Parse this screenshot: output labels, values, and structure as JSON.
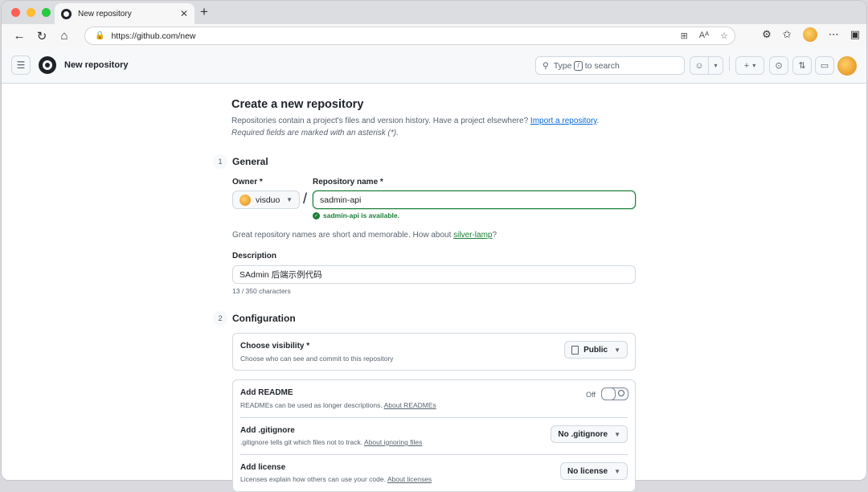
{
  "browser": {
    "tab_title": "New repository",
    "url": "https://github.com/new"
  },
  "header": {
    "context_title": "New repository",
    "search_prefix": "Type",
    "search_key": "/",
    "search_suffix": "to search"
  },
  "page": {
    "title": "Create a new repository",
    "intro": "Repositories contain a project's files and version history. Have a project elsewhere?",
    "import_link": "Import a repository",
    "intro_end": ".",
    "required_note": "Required fields are marked with an asterisk (*)."
  },
  "general": {
    "step": "1",
    "title": "General",
    "owner_label": "Owner *",
    "owner_value": "visduo",
    "slash": "/",
    "repo_label": "Repository name *",
    "repo_value": "sadmin-api",
    "available_msg": "sadmin-api is available.",
    "suggest_text": "Great repository names are short and memorable. How about",
    "suggest_link": "silver-lamp",
    "suggest_end": "?",
    "description_label": "Description",
    "description_value": "SAdmin 后端示例代码",
    "char_count": "13 / 350 characters"
  },
  "configuration": {
    "step": "2",
    "title": "Configuration",
    "visibility_title": "Choose visibility *",
    "visibility_desc": "Choose who can see and commit to this repository",
    "visibility_value": "Public",
    "readme_title": "Add README",
    "readme_desc": "READMEs can be used as longer descriptions.",
    "readme_link": "About READMEs",
    "readme_state": "Off",
    "gitignore_title": "Add .gitignore",
    "gitignore_desc": ".gitignore tells git which files not to track.",
    "gitignore_link": "About ignoring files",
    "gitignore_value": "No .gitignore",
    "license_title": "Add license",
    "license_desc": "Licenses explain how others can use your code.",
    "license_link": "About licenses",
    "license_value": "No license"
  },
  "colors": {
    "success": "#1a7f37",
    "link": "#0969da",
    "border": "#d1d9e0"
  }
}
